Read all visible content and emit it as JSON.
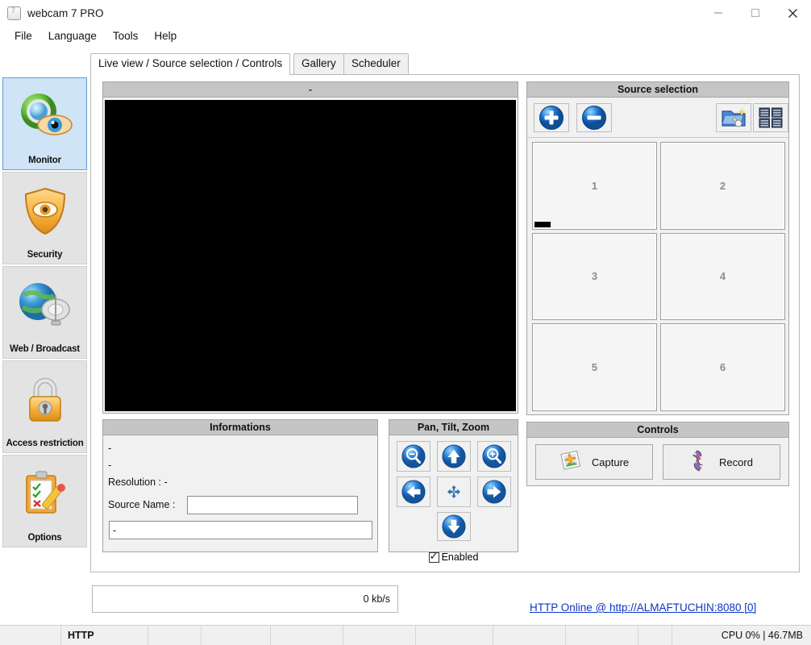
{
  "window": {
    "title": "webcam 7 PRO",
    "icon": "app-icon",
    "minimize_label": "–",
    "maximize_label": "□",
    "close_label": "✕"
  },
  "menubar": {
    "items": [
      {
        "label": "File"
      },
      {
        "label": "Language"
      },
      {
        "label": "Tools"
      },
      {
        "label": "Help"
      }
    ]
  },
  "sidebar": {
    "items": [
      {
        "label": "Monitor",
        "icon": "monitor-eye-icon",
        "selected": true
      },
      {
        "label": "Security",
        "icon": "shield-eye-icon",
        "selected": false
      },
      {
        "label": "Web / Broadcast",
        "icon": "globe-satellite-icon",
        "selected": false
      },
      {
        "label": "Access restriction",
        "icon": "padlock-icon",
        "selected": false
      },
      {
        "label": "Options",
        "icon": "clipboard-pencil-icon",
        "selected": false
      }
    ]
  },
  "tabs": [
    {
      "label": "Live view / Source selection / Controls",
      "active": true
    },
    {
      "label": "Gallery",
      "active": false
    },
    {
      "label": "Scheduler",
      "active": false
    }
  ],
  "video": {
    "header_title": "-",
    "surface_color": "#000000"
  },
  "informations": {
    "title": "Informations",
    "line1": "-",
    "line2": "-",
    "resolution_label": "Resolution : -",
    "source_name_label": "Source Name :",
    "source_name_value": "",
    "source_name_placeholder": "",
    "status_value": "-"
  },
  "ptz": {
    "title": "Pan, Tilt, Zoom",
    "buttons": [
      {
        "name": "zoom-out-icon",
        "tip": "Zoom out"
      },
      {
        "name": "arrow-up-icon",
        "tip": "Tilt up"
      },
      {
        "name": "zoom-in-icon",
        "tip": "Zoom in"
      },
      {
        "name": "arrow-left-icon",
        "tip": "Pan left"
      },
      {
        "name": "center-home-icon",
        "tip": "Center"
      },
      {
        "name": "arrow-right-icon",
        "tip": "Pan right"
      },
      {
        "name": "arrow-down-icon",
        "tip": "Tilt down"
      }
    ],
    "enabled_label": "Enabled",
    "enabled_checked": true
  },
  "source_selection": {
    "title": "Source selection",
    "toolbar": [
      {
        "name": "add-source-icon",
        "label": "+"
      },
      {
        "name": "remove-source-icon",
        "label": "−"
      },
      {
        "name": "source-wizard-icon",
        "label": ""
      },
      {
        "name": "grid-view-icon",
        "label": ""
      }
    ],
    "cells": [
      {
        "label": "1",
        "active": true
      },
      {
        "label": "2",
        "active": false
      },
      {
        "label": "3",
        "active": false
      },
      {
        "label": "4",
        "active": false
      },
      {
        "label": "5",
        "active": false
      },
      {
        "label": "6",
        "active": false
      }
    ]
  },
  "controls": {
    "title": "Controls",
    "capture_label": "Capture",
    "capture_icon": "photo-icon",
    "record_label": "Record",
    "record_icon": "film-strip-icon"
  },
  "bandwidth": {
    "value": "0 kb/s"
  },
  "http_link": {
    "text": "HTTP Online @ http://ALMAFTUCHIN:8080 [0]",
    "color": "#0b35c6"
  },
  "statusbar": {
    "cells": [
      "",
      "HTTP",
      "",
      "",
      "",
      "",
      "",
      "",
      "",
      ""
    ],
    "right": "CPU 0% | 46.7MB"
  },
  "colors": {
    "accent": "#1b6fd4",
    "selected_sidebar_bg": "#cfe4f7",
    "group_header": "#c5c5c5",
    "panel_bg": "#f1f1f1"
  }
}
